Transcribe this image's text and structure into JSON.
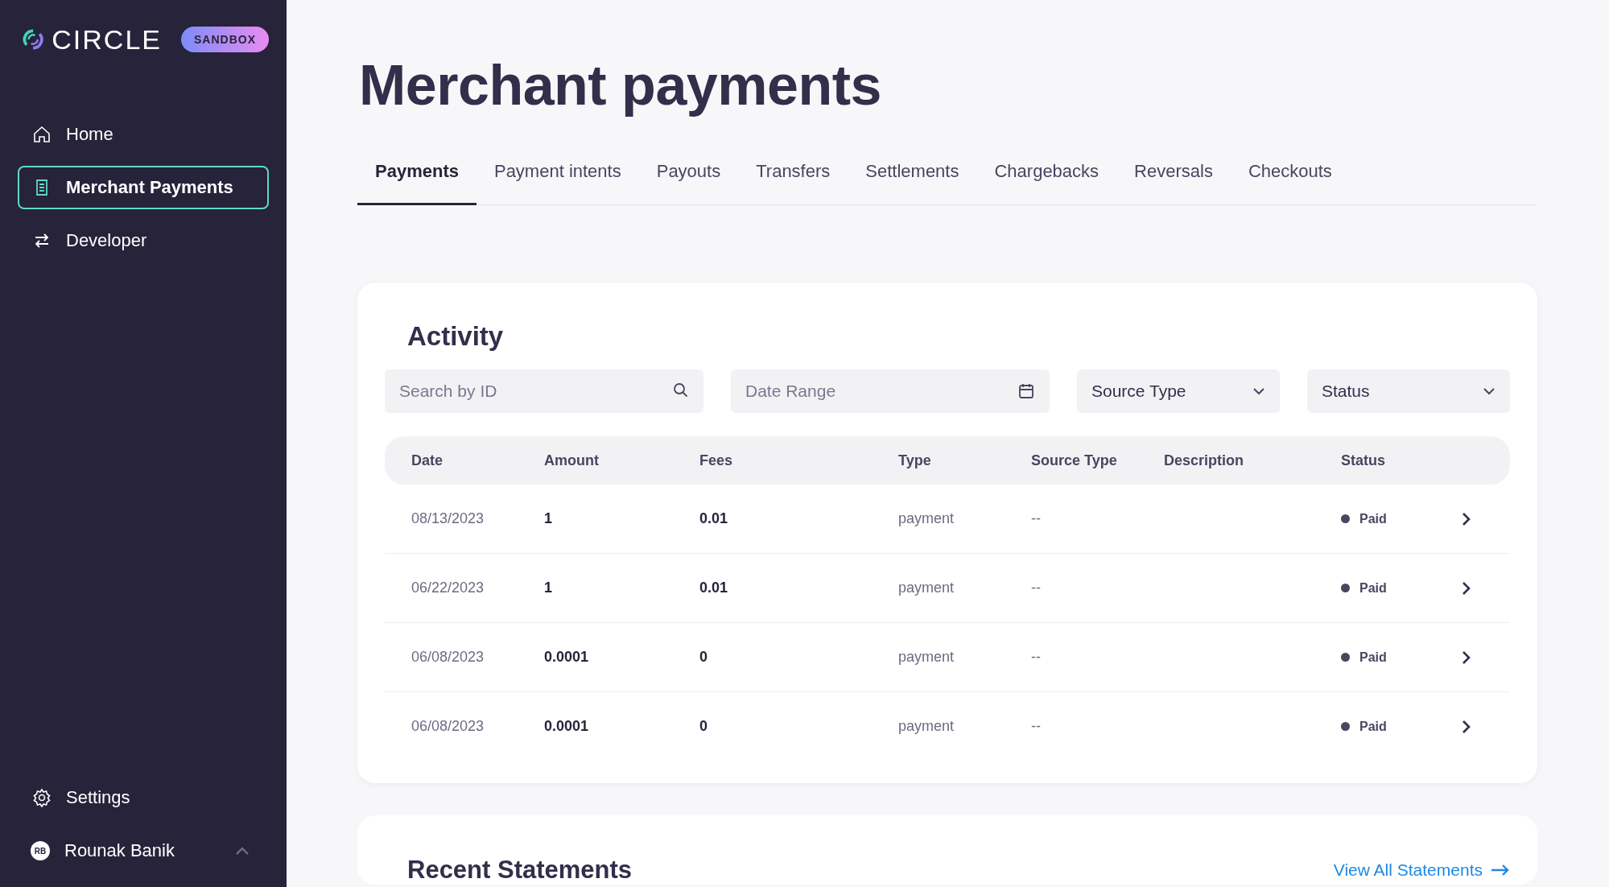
{
  "sidebar": {
    "logo": "CIRCLE",
    "badge": "SANDBOX",
    "nav": [
      {
        "label": "Home",
        "selected": false
      },
      {
        "label": "Merchant Payments",
        "selected": true
      },
      {
        "label": "Developer",
        "selected": false
      }
    ],
    "settings": "Settings",
    "user": {
      "initials": "RB",
      "name": "Rounak Banik"
    }
  },
  "page_title": "Merchant payments",
  "tabs": [
    {
      "label": "Payments",
      "selected": true
    },
    {
      "label": "Payment intents",
      "selected": false
    },
    {
      "label": "Payouts",
      "selected": false
    },
    {
      "label": "Transfers",
      "selected": false
    },
    {
      "label": "Settlements",
      "selected": false
    },
    {
      "label": "Chargebacks",
      "selected": false
    },
    {
      "label": "Reversals",
      "selected": false
    },
    {
      "label": "Checkouts",
      "selected": false
    }
  ],
  "activity": {
    "title": "Activity",
    "filters": [
      {
        "kind": "search",
        "placeholder": "Search by ID"
      },
      {
        "kind": "date",
        "placeholder": "Date Range"
      },
      {
        "kind": "select",
        "label": "Source Type"
      },
      {
        "kind": "select",
        "label": "Status"
      }
    ],
    "columns": [
      "Date",
      "Amount",
      "Fees",
      "Type",
      "Source Type",
      "Description",
      "Status"
    ],
    "rows": [
      {
        "date": "08/13/2023",
        "amount": "1",
        "fees": "0.01",
        "type": "payment",
        "source_type": "--",
        "status": "Paid"
      },
      {
        "date": "06/22/2023",
        "amount": "1",
        "fees": "0.01",
        "type": "payment",
        "source_type": "--",
        "status": "Paid"
      },
      {
        "date": "06/08/2023",
        "amount": "0.0001",
        "fees": "0",
        "type": "payment",
        "source_type": "--",
        "status": "Paid"
      },
      {
        "date": "06/08/2023",
        "amount": "0.0001",
        "fees": "0",
        "type": "payment",
        "source_type": "--",
        "status": "Paid"
      }
    ]
  },
  "statements": {
    "title": "Recent Statements",
    "link": "View All Statements"
  }
}
